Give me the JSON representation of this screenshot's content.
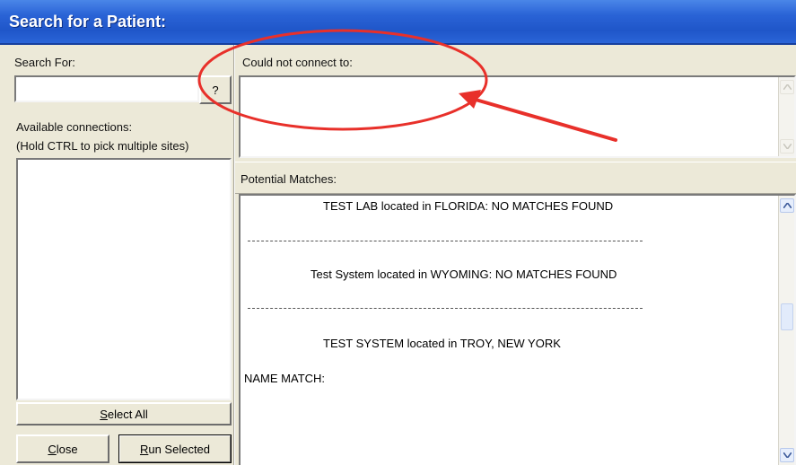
{
  "window": {
    "title": "Search for a Patient:"
  },
  "left_panel": {
    "search_for_label": "Search For:",
    "search_input_value": "",
    "help_button_label": "?",
    "available_connections_label": "Available connections:",
    "hold_ctrl_hint": "(Hold CTRL to pick multiple sites)",
    "connections": [],
    "select_all": {
      "underline": "S",
      "rest": "elect All"
    },
    "close": {
      "underline": "C",
      "rest": "lose"
    },
    "run_selected": {
      "underline": "R",
      "rest": "un Selected"
    }
  },
  "could_not_connect": {
    "label": "Could not connect to:",
    "value": ""
  },
  "potential_matches": {
    "label": "Potential Matches:",
    "lines": [
      "TEST LAB located in FLORIDA: NO MATCHES FOUND",
      "------------------------------------------------------------------------------------------------------------------------",
      "Test System located in WYOMING: NO MATCHES FOUND",
      "------------------------------------------------------------------------------------------------------------------------",
      "TEST SYSTEM located in TROY, NEW YORK",
      "NAME MATCH:"
    ]
  },
  "annotation": {
    "shape": "ellipse-with-arrow",
    "color": "#e8302a"
  }
}
